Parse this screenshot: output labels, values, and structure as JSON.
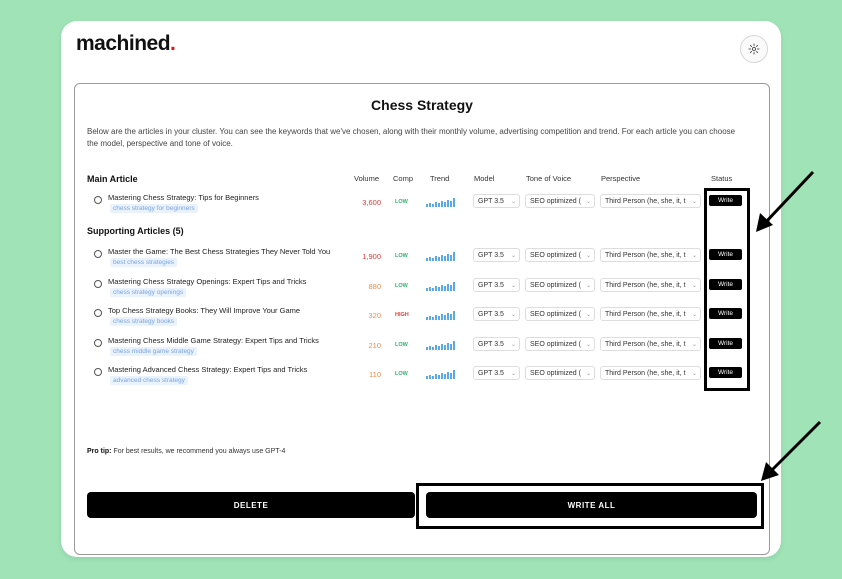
{
  "app": {
    "logo": "machined",
    "logo_dot": "."
  },
  "page": {
    "title": "Chess Strategy",
    "description": "Below are the articles in your cluster. You can see the keywords that we've chosen, along with their monthly volume, advertising competition and trend. For each article you can choose the model, perspective and tone of voice."
  },
  "sections": {
    "main": "Main Article",
    "supporting": "Supporting Articles (5)"
  },
  "columns": {
    "volume": "Volume",
    "comp": "Comp",
    "trend": "Trend",
    "model": "Model",
    "tone": "Tone of Voice",
    "perspective": "Perspective",
    "status": "Status"
  },
  "rows": [
    {
      "title": "Mastering Chess Strategy: Tips for Beginners",
      "keyword": "chess strategy for beginners",
      "volume": "3,600",
      "comp": "LOW",
      "model": "GPT 3.5",
      "tone": "SEO optimized (",
      "perspective": "Third Person (he, she, it, t",
      "write": "Write"
    },
    {
      "title": "Master the Game: The Best Chess Strategies They Never Told You",
      "keyword": "best chess strategies",
      "volume": "1,900",
      "comp": "LOW",
      "model": "GPT 3.5",
      "tone": "SEO optimized (",
      "perspective": "Third Person (he, she, it, t",
      "write": "Write"
    },
    {
      "title": "Mastering Chess Strategy Openings: Expert Tips and Tricks",
      "keyword": "chess strategy openings",
      "volume": "880",
      "comp": "LOW",
      "model": "GPT 3.5",
      "tone": "SEO optimized (",
      "perspective": "Third Person (he, she, it, t",
      "write": "Write"
    },
    {
      "title": "Top Chess Strategy Books: They Will Improve Your Game",
      "keyword": "chess strategy books",
      "volume": "320",
      "comp": "HIGH",
      "model": "GPT 3.5",
      "tone": "SEO optimized (",
      "perspective": "Third Person (he, she, it, t",
      "write": "Write"
    },
    {
      "title": "Mastering Chess Middle Game Strategy: Expert Tips and Tricks",
      "keyword": "chess middle game strategy",
      "volume": "210",
      "comp": "LOW",
      "model": "GPT 3.5",
      "tone": "SEO optimized (",
      "perspective": "Third Person (he, she, it, t",
      "write": "Write"
    },
    {
      "title": "Mastering Advanced Chess Strategy: Expert Tips and Tricks",
      "keyword": "advanced chess strategy",
      "volume": "110",
      "comp": "LOW",
      "model": "GPT 3.5",
      "tone": "SEO optimized (",
      "perspective": "Third Person (he, she, it, t",
      "write": "Write"
    }
  ],
  "pro_tip": {
    "label": "Pro tip:",
    "text": "For best results, we recommend you always use GPT-4"
  },
  "buttons": {
    "delete": "DELETE",
    "write_all": "WRITE ALL"
  },
  "colors": {
    "background": "#9fe3b7",
    "accent_dot": "#e11111",
    "comp_low": "#2fb36a",
    "comp_high": "#e53935",
    "trend_bars": "#5aa9e6",
    "annotation": "#000000"
  },
  "icons": {
    "settings": "gear-icon",
    "row": "circle-icon"
  }
}
